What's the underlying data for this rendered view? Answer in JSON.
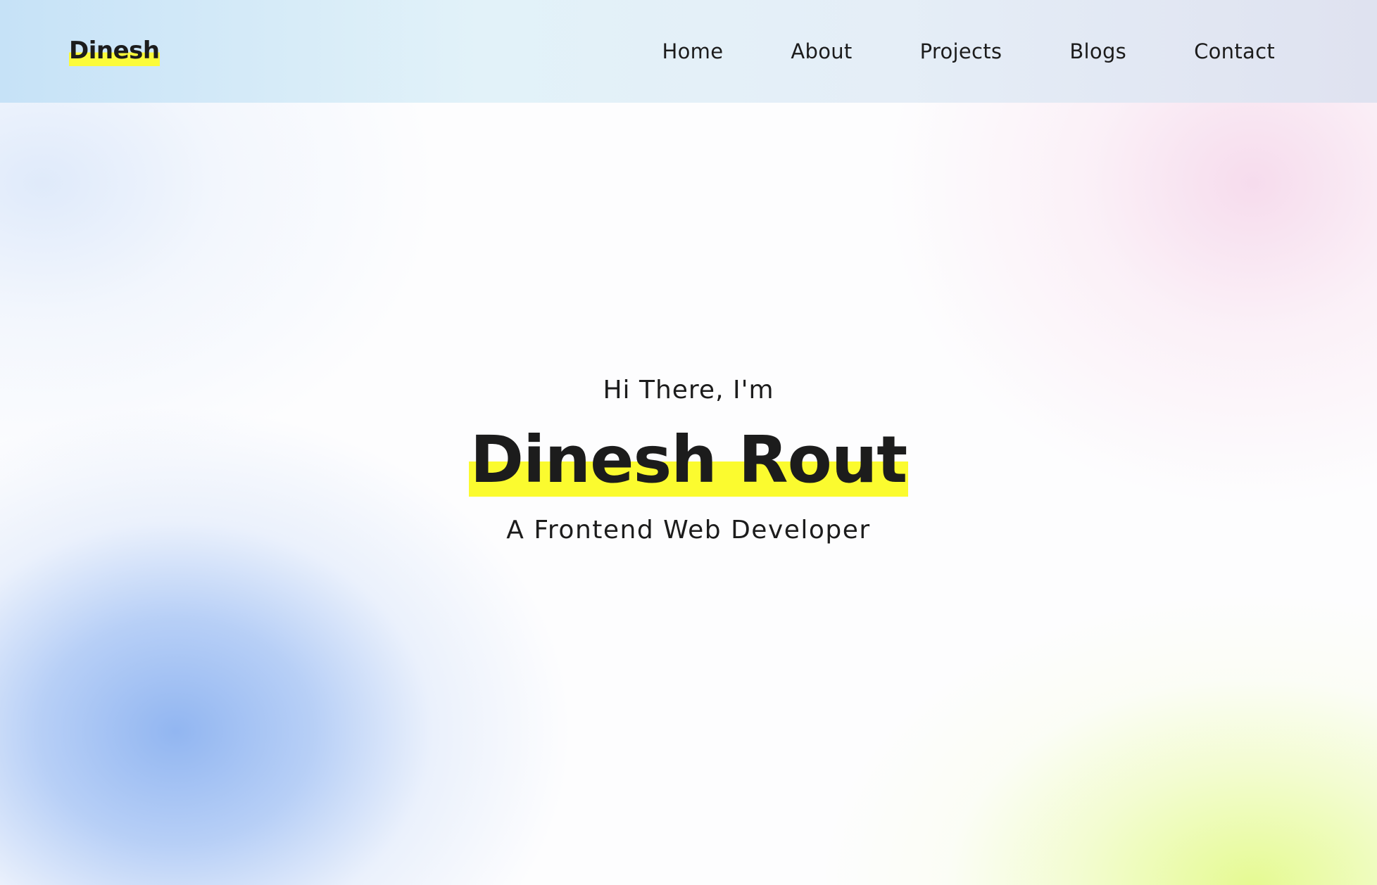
{
  "navbar": {
    "brand": "Dinesh",
    "links": [
      "Home",
      "About",
      "Projects",
      "Blogs",
      "Contact"
    ]
  },
  "hero": {
    "greeting": "Hi There, I'm",
    "name": "Dinesh Rout",
    "role": "A Frontend Web Developer"
  },
  "colors": {
    "highlight": "#fbfb2f",
    "text": "#1c1c1c",
    "blob_blue": "#8cb2f0",
    "blob_green": "#e4fa8c",
    "blob_pink": "#f6daec"
  }
}
